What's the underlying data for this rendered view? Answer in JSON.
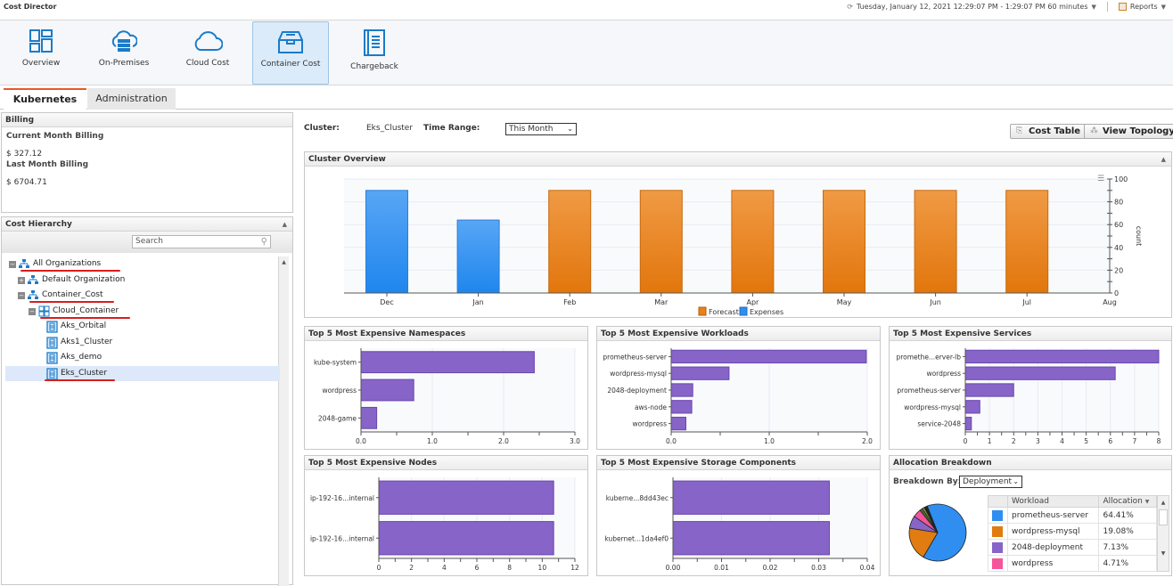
{
  "app": {
    "title": "Cost Director",
    "time_range_text": "Tuesday, January 12, 2021 12:29:07 PM - 1:29:07 PM 60 minutes",
    "reports_label": "Reports"
  },
  "nav": {
    "items": [
      {
        "label": "Overview",
        "icon": "dashboard-grid-icon"
      },
      {
        "label": "On-Premises",
        "icon": "cloud-server-icon"
      },
      {
        "label": "Cloud Cost",
        "icon": "cloud-icon"
      },
      {
        "label": "Container Cost",
        "icon": "container-box-icon",
        "active": true
      },
      {
        "label": "Chargeback",
        "icon": "ledger-book-icon"
      }
    ]
  },
  "tabs": [
    {
      "label": "Kubernetes",
      "active": true
    },
    {
      "label": "Administration",
      "active": false
    }
  ],
  "billing": {
    "title": "Billing",
    "current_label": "Current Month Billing",
    "current_value": "$ 327.12",
    "last_label": "Last Month Billing",
    "last_value": "$ 6704.71"
  },
  "hierarchy": {
    "title": "Cost Hierarchy",
    "search_placeholder": "Search",
    "nodes": [
      {
        "label": "All Organizations",
        "level": 0,
        "toggle": "-",
        "icon": "organization-icon",
        "underlined": true
      },
      {
        "label": "Default Organization",
        "level": 1,
        "toggle": "+",
        "icon": "organization-icon"
      },
      {
        "label": "Container_Cost",
        "level": 1,
        "toggle": "-",
        "icon": "organization-icon",
        "underlined": true
      },
      {
        "label": "Cloud_Container",
        "level": 2,
        "toggle": "-",
        "icon": "container-group-icon",
        "underlined": true
      },
      {
        "label": "Aks_Orbital",
        "level": 3,
        "icon": "cluster-icon"
      },
      {
        "label": "Aks1_Cluster",
        "level": 3,
        "icon": "cluster-icon"
      },
      {
        "label": "Aks_demo",
        "level": 3,
        "icon": "cluster-icon"
      },
      {
        "label": "Eks_Cluster",
        "level": 3,
        "icon": "cluster-icon",
        "selected": true,
        "underlined": true
      }
    ]
  },
  "filters": {
    "cluster_label": "Cluster:",
    "cluster_value": "Eks_Cluster",
    "time_range_label": "Time Range:",
    "time_range_value": "This Month"
  },
  "buttons": {
    "cost_table": "Cost Table",
    "view_topology": "View Topology"
  },
  "colors": {
    "forecast": "#e8801c",
    "expenses": "#2f8ef0",
    "bar": "#8764c8",
    "accent": "#e8572a"
  },
  "chart_data": [
    {
      "id": "cluster-overview",
      "title": "Cluster Overview",
      "type": "bar",
      "categories": [
        "Dec",
        "Jan",
        "Feb",
        "Mar",
        "Apr",
        "May",
        "Jun",
        "Jul"
      ],
      "extra_tick": "Aug",
      "series": [
        {
          "name": "Forecast",
          "values": [
            null,
            null,
            90,
            90,
            90,
            90,
            90,
            90
          ]
        },
        {
          "name": "Expenses",
          "values": [
            90,
            64,
            null,
            null,
            null,
            null,
            null,
            null
          ]
        }
      ],
      "ylabel": "count",
      "ylim": [
        0,
        100
      ],
      "yticks": [
        0,
        20,
        40,
        60,
        80,
        100
      ],
      "legend": [
        "Forecast",
        "Expenses"
      ],
      "legend_position": "bottom"
    },
    {
      "id": "namespaces",
      "title": "Top 5 Most Expensive Namespaces",
      "type": "bar",
      "orientation": "horizontal",
      "categories": [
        "kube-system",
        "wordpress",
        "2048-game"
      ],
      "values": [
        2.43,
        0.74,
        0.22
      ],
      "xlim": [
        0,
        3
      ],
      "xticks": [
        "0.0",
        "1.0",
        "2.0",
        "3.0"
      ],
      "minor_step": 0.5
    },
    {
      "id": "workloads",
      "title": "Top 5 Most Expensive Workloads",
      "type": "bar",
      "orientation": "horizontal",
      "categories": [
        "prometheus-server",
        "wordpress-mysql",
        "2048-deployment",
        "aws-node",
        "wordpress"
      ],
      "values": [
        1.99,
        0.59,
        0.22,
        0.21,
        0.15
      ],
      "xlim": [
        0,
        2
      ],
      "xticks": [
        "0.0",
        "1.0",
        "2.0"
      ],
      "minor_step": 0.5
    },
    {
      "id": "services",
      "title": "Top 5 Most Expensive Services",
      "type": "bar",
      "orientation": "horizontal",
      "categories": [
        "promethe...erver-lb",
        "wordpress",
        "prometheus-server",
        "wordpress-mysql",
        "service-2048"
      ],
      "values": [
        8.0,
        6.2,
        2.0,
        0.6,
        0.25
      ],
      "xlim": [
        0,
        8
      ],
      "xticks": [
        "0",
        "1",
        "2",
        "3",
        "4",
        "5",
        "6",
        "7",
        "8"
      ],
      "minor_step": 0.5
    },
    {
      "id": "nodes",
      "title": "Top 5 Most Expensive Nodes",
      "type": "bar",
      "orientation": "horizontal",
      "categories": [
        "ip-192-16...internal",
        "ip-192-16...internal"
      ],
      "values": [
        10.7,
        10.7
      ],
      "xlim": [
        0,
        12
      ],
      "xticks": [
        "0",
        "2",
        "4",
        "6",
        "8",
        "10",
        "12"
      ],
      "minor_step": 1
    },
    {
      "id": "storage",
      "title": "Top 5 Most Expensive Storage Components",
      "type": "bar",
      "orientation": "horizontal",
      "categories": [
        "kuberne...8dd43ec",
        "kubernet...1da4ef0"
      ],
      "values": [
        0.0322,
        0.0322
      ],
      "xlim": [
        0,
        0.04
      ],
      "xticks": [
        "0.00",
        "0.01",
        "0.02",
        "0.03",
        "0.04"
      ],
      "minor_step": 0.005
    },
    {
      "id": "allocation",
      "title": "Allocation Breakdown",
      "type": "pie",
      "breakdown_label": "Breakdown By:",
      "breakdown_value": "Deployment",
      "columns": [
        "Workload",
        "Allocation"
      ],
      "rows": [
        {
          "name": "prometheus-server",
          "value": "64.41%",
          "pct": 64.41,
          "color": "#2f8ef0"
        },
        {
          "name": "wordpress-mysql",
          "value": "19.08%",
          "pct": 19.08,
          "color": "#e07c10"
        },
        {
          "name": "2048-deployment",
          "value": "7.13%",
          "pct": 7.13,
          "color": "#8764c8"
        },
        {
          "name": "wordpress",
          "value": "4.71%",
          "pct": 4.71,
          "color": "#f4559a"
        }
      ],
      "other_slices": [
        {
          "pct": 1.6,
          "color": "#556b2f"
        },
        {
          "pct": 1.3,
          "color": "#7a9a3a"
        },
        {
          "pct": 1.77,
          "color": "#222222"
        }
      ]
    }
  ]
}
